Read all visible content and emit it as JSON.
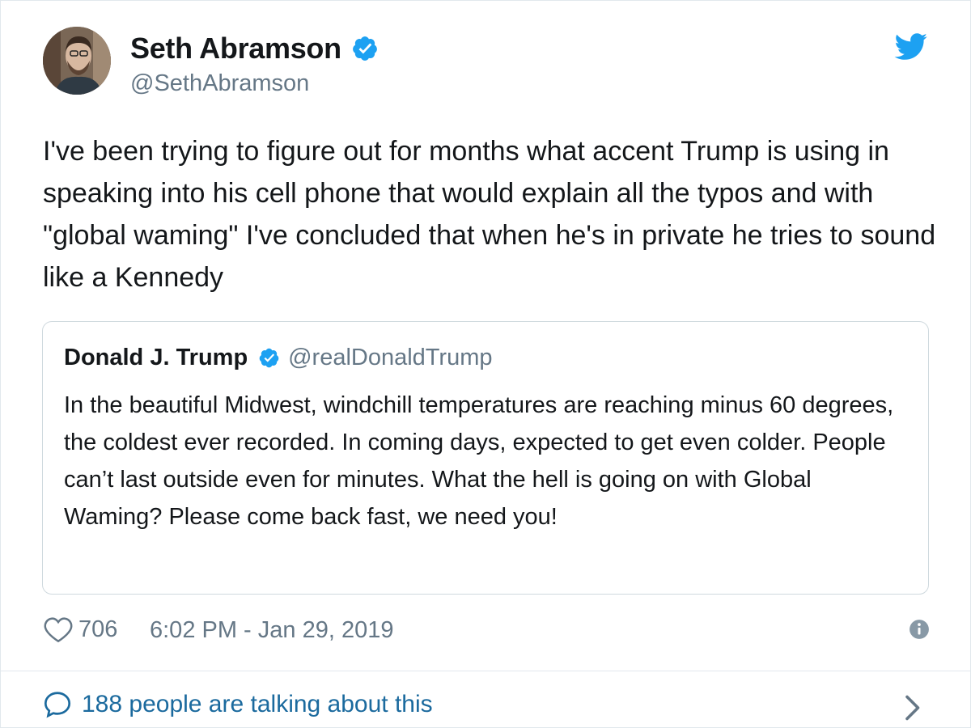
{
  "author": {
    "display_name": "Seth Abramson",
    "handle": "@SethAbramson",
    "verified": true
  },
  "tweet": {
    "text": "I've been trying to figure out for months what accent Trump is using in speaking into his cell phone that would explain all the typos and with \"global waming\" I've concluded that when he's in private he tries to sound like a Kennedy"
  },
  "quoted_tweet": {
    "display_name": "Donald J. Trump",
    "handle": "@realDonaldTrump",
    "verified": true,
    "text": "In the beautiful Midwest, windchill temperatures are reaching minus 60 degrees, the coldest ever recorded. In coming days, expected to get even colder. People can’t last outside even for minutes. What the hell is going on with Global Waming? Please come back fast, we need you!"
  },
  "footer": {
    "like_count": "706",
    "timestamp": "6:02 PM - Jan 29, 2019"
  },
  "conversation": {
    "label": "188 people are talking about this"
  },
  "icons": {
    "verified": "verified-badge-icon",
    "twitter": "twitter-bird-icon",
    "like": "heart-icon",
    "info": "info-icon",
    "reply": "speech-bubble-icon",
    "chevron": "chevron-right-icon"
  },
  "colors": {
    "accent": "#1da1f2",
    "link": "#1b6a9e",
    "muted": "#657786",
    "text": "#14171a",
    "border": "#e1e8ed"
  }
}
